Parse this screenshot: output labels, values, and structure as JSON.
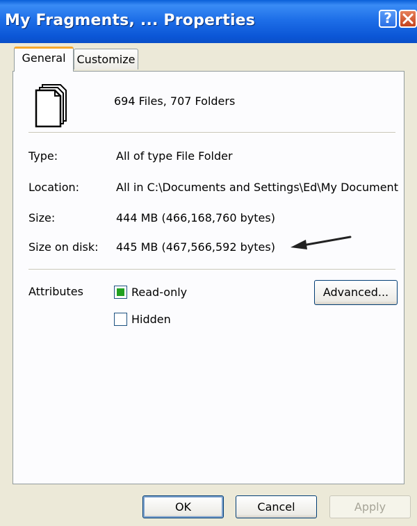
{
  "window": {
    "title": "My Fragments, ... Properties",
    "help_label": "?"
  },
  "tabs": [
    {
      "label": "General"
    },
    {
      "label": "Customize"
    }
  ],
  "general": {
    "summary": "694 Files, 707 Folders",
    "rows": [
      {
        "label": "Type:",
        "value": "All of type File Folder"
      },
      {
        "label": "Location:",
        "value": "All in C:\\Documents and Settings\\Ed\\My Document"
      },
      {
        "label": "Size:",
        "value": "444 MB (466,168,760 bytes)"
      },
      {
        "label": "Size on disk:",
        "value": "445 MB (467,566,592 bytes)"
      }
    ],
    "attributes_label": "Attributes",
    "readonly_label": "Read-only",
    "readonly_state": "mixed",
    "hidden_label": "Hidden",
    "hidden_state": "unchecked",
    "advanced_label": "Advanced..."
  },
  "buttons": {
    "ok": "OK",
    "cancel": "Cancel",
    "apply": "Apply"
  },
  "colors": {
    "title_bar": "#0b56d6",
    "checkbox_fill": "#21a121",
    "active_tab_accent": "#f6a82c"
  }
}
